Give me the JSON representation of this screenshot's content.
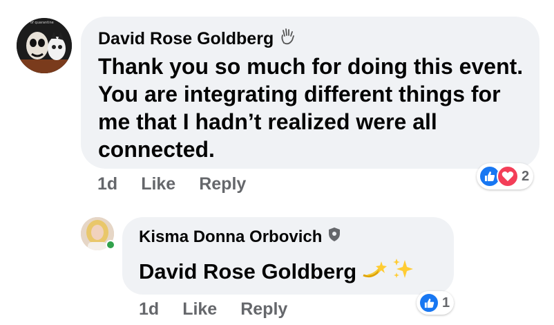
{
  "comments": [
    {
      "author": "David Rose Goldberg",
      "author_badge": "waving-hand-icon",
      "text": "Thank you so much for doing this event. You are integrating different things for me that I hadn’t realized were all connected.",
      "time": "1d",
      "like_label": "Like",
      "reply_label": "Reply",
      "reactions": [
        "like",
        "love"
      ],
      "reaction_count": "2",
      "avatar_caption": "of quarantine"
    }
  ],
  "replies": [
    {
      "author": "Kisma Donna Orbovich",
      "author_badge": "shield-icon",
      "mention": "David Rose Goldberg",
      "emojis": [
        "dizzy-icon",
        "sparkles-icon"
      ],
      "time": "1d",
      "like_label": "Like",
      "reply_label": "Reply",
      "reactions": [
        "like"
      ],
      "reaction_count": "1",
      "online": true
    }
  ],
  "colors": {
    "bubble": "#f0f2f5",
    "like_blue": "#1877f2",
    "love_red": "#f33e58",
    "muted_text": "#65676b",
    "online_green": "#31a24c"
  }
}
